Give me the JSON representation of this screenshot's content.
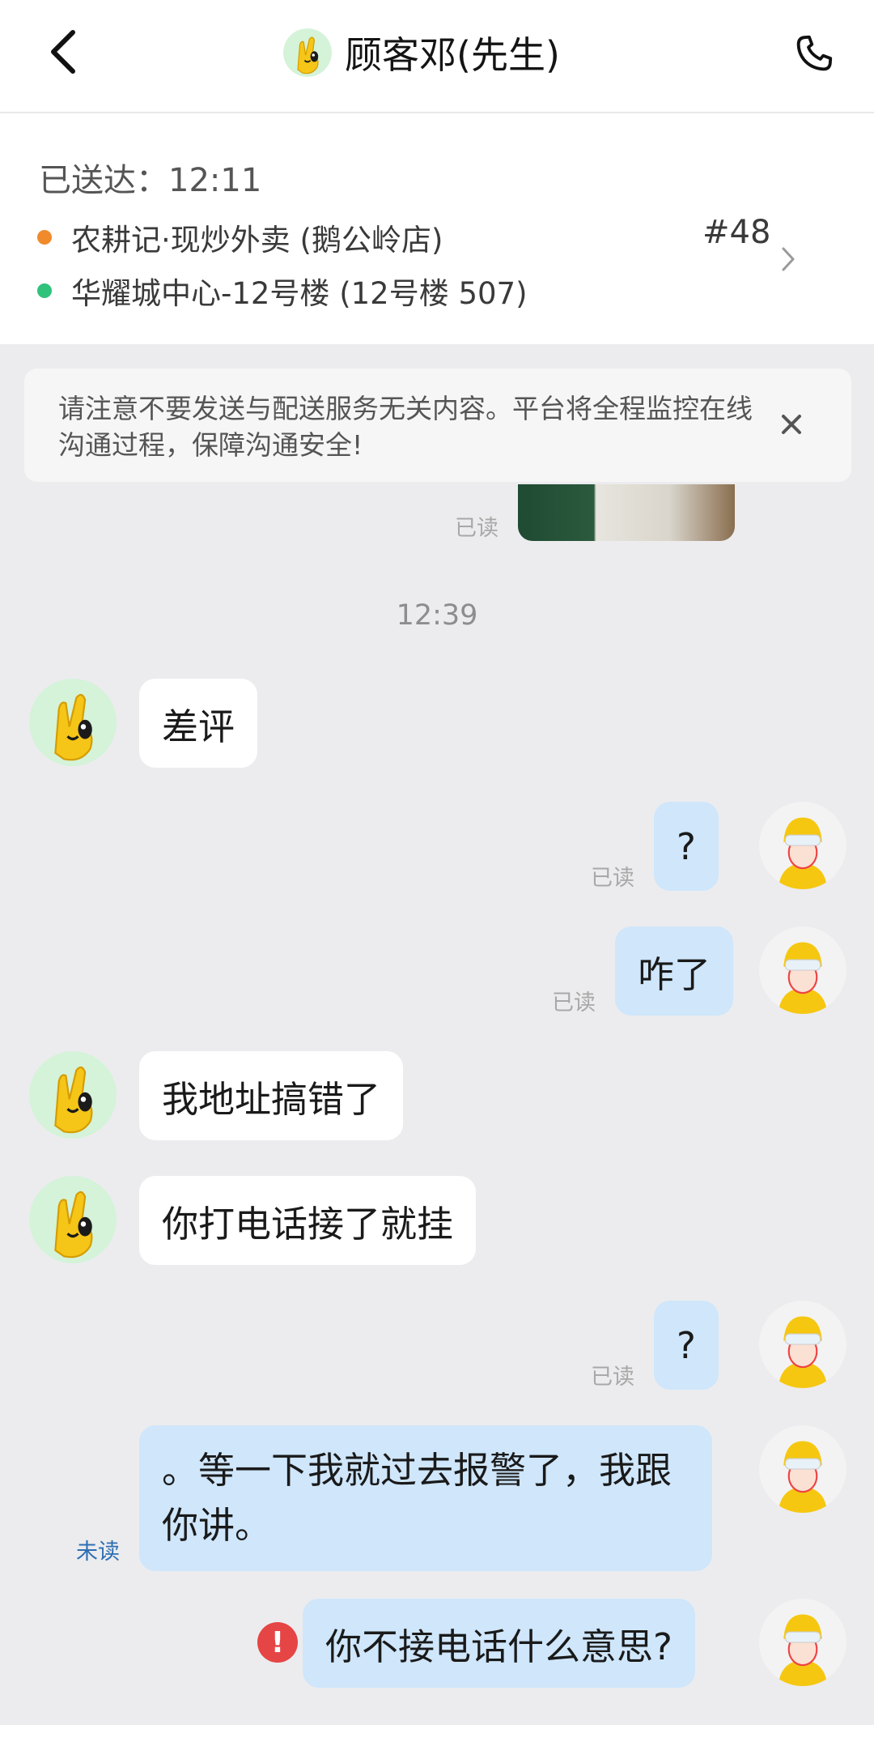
{
  "header": {
    "title": "顾客邓(先生)"
  },
  "order": {
    "delivered": "已送达：12:11",
    "store": "农耕记·现炒外卖 (鹅公岭店)",
    "address": "华耀城中心-12号楼 (12号楼  507)",
    "order_number": "#48"
  },
  "notice": {
    "text": "请注意不要发送与配送服务无关内容。平台将全程监控在线沟通过程，保障沟通安全!"
  },
  "chat": {
    "image_status": "已读",
    "timestamp": "12:39",
    "messages": [
      {
        "from": "customer",
        "text": "差评"
      },
      {
        "from": "rider",
        "text": "?",
        "status": "已读"
      },
      {
        "from": "rider",
        "text": "咋了",
        "status": "已读"
      },
      {
        "from": "customer",
        "text": "我地址搞错了"
      },
      {
        "from": "customer",
        "text": "你打电话接了就挂"
      },
      {
        "from": "rider",
        "text": "?",
        "status": "已读"
      },
      {
        "from": "rider",
        "text": "。等一下我就过去报警了，我跟你讲。",
        "status": "未读"
      },
      {
        "from": "rider",
        "text": "你不接电话什么意思?",
        "status": "failed"
      }
    ]
  },
  "colors": {
    "background": "#ececee",
    "outgoing_bubble": "#cfe6fb",
    "incoming_bubble": "#ffffff",
    "store_dot": "#f08a2b",
    "address_dot": "#2fc27a",
    "error": "#e64545",
    "unread": "#2f6fb4"
  },
  "icons": {
    "back": "back-arrow-icon",
    "phone": "phone-icon",
    "chevron": "chevron-right-icon",
    "close": "close-icon",
    "error": "error-icon"
  }
}
